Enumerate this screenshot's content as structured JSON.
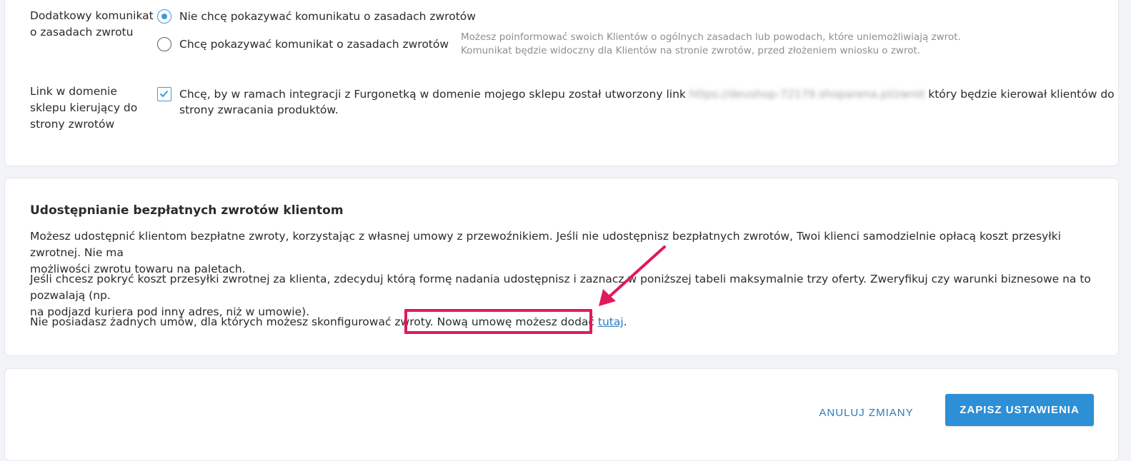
{
  "colors": {
    "accent": "#2d8fd5",
    "link": "#2b7bc0",
    "highlight": "#e0195a",
    "hint": "#8a8f96"
  },
  "returns_message": {
    "label_line1": "Dodatkowy komunikat",
    "label_line2": "o zasadach zwrotu",
    "option_no": "Nie chcę pokazywać komunikatu o zasadach zwrotów",
    "option_yes": "Chcę pokazywać komunikat o zasadach zwrotów",
    "selected": "option_no",
    "hint_line1": "Możesz poinformować swoich Klientów o ogólnych zasadach lub powodach, które uniemożliwiają zwrot.",
    "hint_line2": "Komunikat będzie widoczny dla Klientów na stronie zwrotów, przed złożeniem wniosku o zwrot."
  },
  "store_link": {
    "label_line1": "Link w domenie",
    "label_line2": "sklepu kierujący do",
    "label_line3": "strony zwrotów",
    "checked": true,
    "text_before": "Chcę, by w ramach integracji z Furgonetką w domenie mojego sklepu został utworzony link",
    "url_blurred": "https://devshop-72179.shoparena.pl/zwrot",
    "text_after": "który będzie kierował klientów do",
    "text_line2": "strony zwracania produktów."
  },
  "free_returns": {
    "title": "Udostępnianie bezpłatnych zwrotów klientom",
    "para1_line1": "Możesz udostępnić klientom bezpłatne zwroty, korzystając z własnej umowy z przewoźnikiem. Jeśli nie udostępnisz bezpłatnych zwrotów, Twoi klienci samodzielnie opłacą koszt przesyłki zwrotnej. Nie ma",
    "para1_line2": "możliwości zwrotu towaru na paletach.",
    "para2_line1": "Jeśli chcesz pokryć koszt przesyłki zwrotnej za klienta, zdecyduj którą formę nadania udostępnisz i zaznacz w poniższej tabeli maksymalnie trzy oferty. Zweryfikuj czy warunki biznesowe na to pozwalają (np.",
    "para2_line2": "na podjazd kuriera pod inny adres, niż w umowie).",
    "para3_start": "Nie posiadasz żadnych umów, dla których możesz skonfigurować zwroty.",
    "para3_add": "Nową umowę możesz dodać",
    "para3_link": "tutaj",
    "para3_end": "."
  },
  "actions": {
    "cancel_label": "ANULUJ ZMIANY",
    "save_label": "ZAPISZ USTAWIENIA"
  }
}
